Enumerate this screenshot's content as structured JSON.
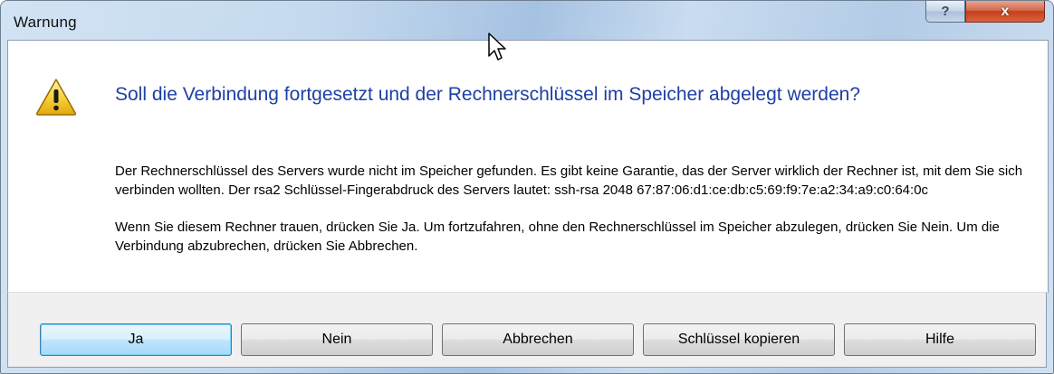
{
  "window": {
    "title": "Warnung",
    "help_button": "?",
    "close_button": "x"
  },
  "main_instruction": "Soll die Verbindung fortgesetzt und der Rechnerschlüssel im Speicher abgelegt werden?",
  "content": {
    "paragraph1": "Der Rechnerschlüssel des Servers wurde nicht im Speicher gefunden. Es gibt keine Garantie, das der Server wirklich der Rechner ist, mit dem Sie sich verbinden wollten. Der rsa2 Schlüssel-Fingerabdruck des Servers lautet: ssh-rsa 2048 67:87:06:d1:ce:db:c5:69:f9:7e:a2:34:a9:c0:64:0c",
    "paragraph2": "Wenn Sie diesem Rechner trauen, drücken Sie Ja. Um fortzufahren, ohne den Rechnerschlüssel im Speicher abzulegen, drücken Sie Nein. Um die Verbindung abzubrechen, drücken Sie Abbrechen."
  },
  "buttons": {
    "yes": "Ja",
    "no": "Nein",
    "cancel": "Abbrechen",
    "copy_key": "Schlüssel kopieren",
    "help": "Hilfe"
  },
  "icons": {
    "dialog_icon": "warning-icon",
    "pointer": "mouse-cursor-icon"
  },
  "colors": {
    "instruction_text": "#1e3fa6",
    "close_button": "#c4401b",
    "default_button_border": "#3c7fb1"
  }
}
